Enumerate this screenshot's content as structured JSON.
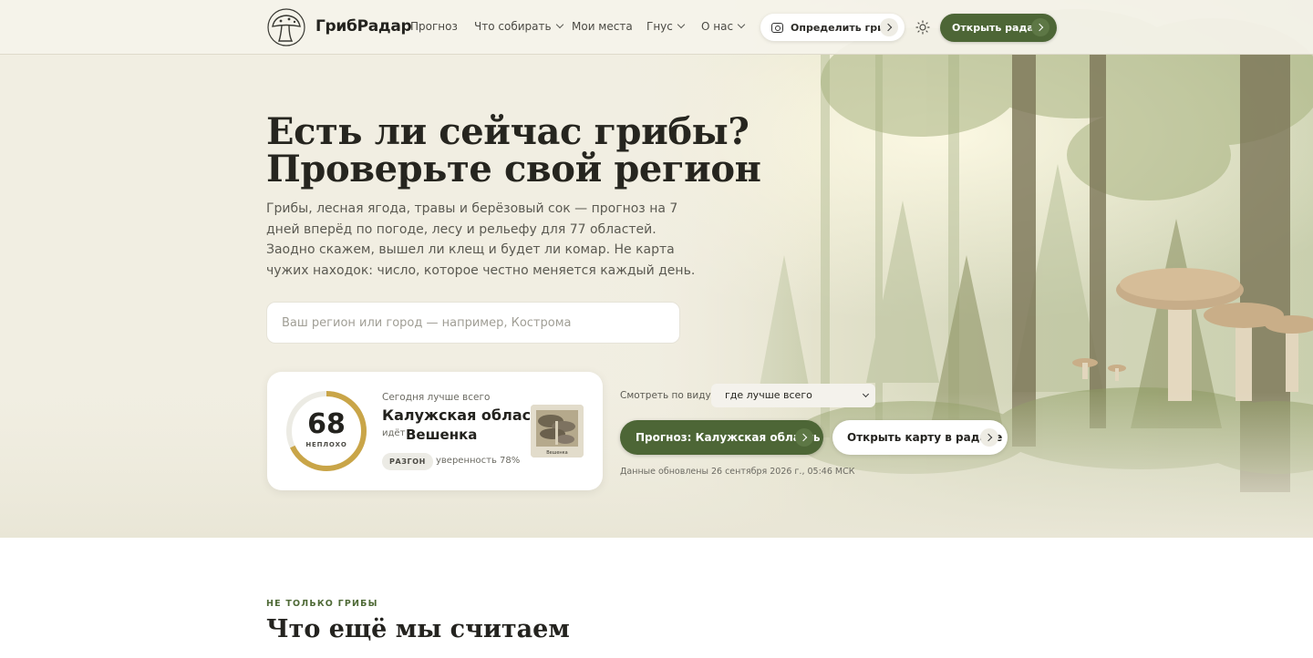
{
  "header": {
    "brand": "ГрибРадар",
    "nav": [
      {
        "label": "Прогноз",
        "dropdown": false
      },
      {
        "label": "Что собирать",
        "dropdown": true
      },
      {
        "label": "Мои места",
        "dropdown": false
      },
      {
        "label": "Гнус",
        "dropdown": true
      },
      {
        "label": "О нас",
        "dropdown": true
      }
    ],
    "identify_button": "Определить гриб",
    "radar_button": "Открыть радар",
    "icons": [
      "mushroom-logo-icon",
      "camera-icon",
      "sun-icon",
      "chevron-right-icon",
      "chevron-down-icon"
    ]
  },
  "hero": {
    "title": "Есть ли сейчас грибы? Проверьте свой регион",
    "subtitle": "Грибы, лесная ягода, травы и берёзовый сок — прогноз на 7 дней вперёд по погоде, лесу и рельефу для 77 областей. Заодно скажем, вышел ли клещ и будет ли комар. Не карта чужих находок: число, которое честно меняется каждый день.",
    "search_placeholder": "Ваш регион или город — например, Кострома"
  },
  "today_card": {
    "score": "68",
    "score_value": 68,
    "score_max": 100,
    "score_label": "НЕПЛОХО",
    "caption": "Сегодня лучше всего",
    "region": "Калужская область",
    "goes_label": "идёт",
    "species": "Вешенка",
    "badge": "РАЗГОН",
    "confidence": "уверенность 78%",
    "thumb_caption": "Вешенка"
  },
  "controls": {
    "view_label": "Смотреть по виду:",
    "view_selected": "где лучше всего",
    "forecast_button": "Прогноз: Калужская область",
    "map_button": "Открыть карту в радаре",
    "updated": "Данные обновлены 26 сентября 2026 г., 05:46 МСК"
  },
  "section": {
    "kicker": "НЕ ТОЛЬКО ГРИБЫ",
    "title": "Что ещё мы считаем"
  },
  "colors": {
    "accent_green": "#4d6636",
    "gauge_gold": "#c9a548",
    "hero_bg": "#f1eee2"
  }
}
